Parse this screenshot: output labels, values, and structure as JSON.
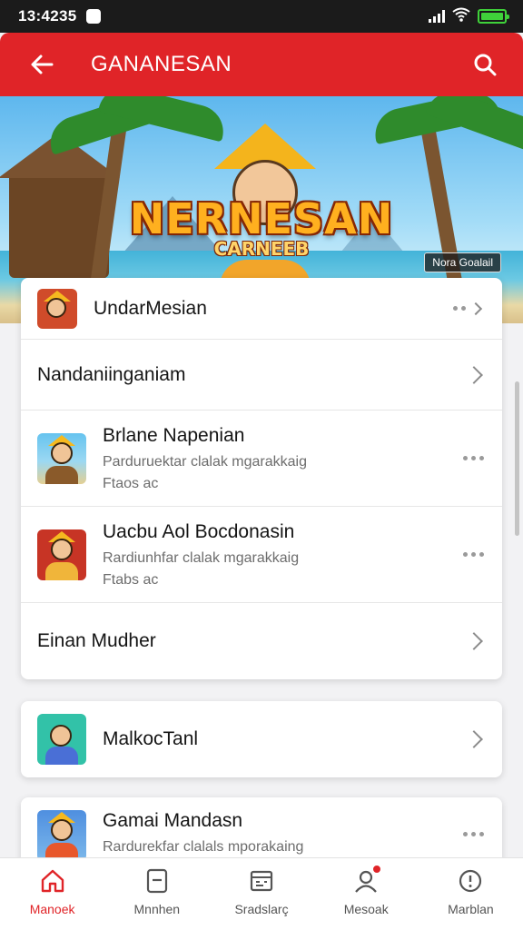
{
  "status_bar": {
    "time": "13:4235"
  },
  "app_bar": {
    "title": "GANANESAN"
  },
  "banner": {
    "logo_line1": "NERNESAN",
    "logo_line2": "CARNEEB",
    "tag": "Nora Goalail"
  },
  "list1": {
    "rows": [
      {
        "title": "UndarMesian"
      },
      {
        "title": "Nandaniinganiam"
      },
      {
        "title": "Brlane Napenian",
        "subtitle": "Parduruektar clalak mgarakkaig",
        "meta": "Ftaos ac"
      },
      {
        "title": "Uacbu Aol Bocdonasin",
        "subtitle": "Rardiunhfar clalak mgarakkaig",
        "meta": "Ftabs ac"
      },
      {
        "title": "Einan Mudher"
      }
    ]
  },
  "list2": {
    "title": "MalkocTanl"
  },
  "list3": {
    "title": "Gamai Mandasn",
    "subtitle": "Rardurekfar clalals mporakaing"
  },
  "bottom_nav": {
    "items": [
      {
        "label": "Manoek",
        "icon": "home-icon",
        "active": true
      },
      {
        "label": "Mnnhen",
        "icon": "tablet-icon"
      },
      {
        "label": "Sradslarç",
        "icon": "calendar-icon"
      },
      {
        "label": "Mesoak",
        "icon": "profile-icon",
        "badge": true
      },
      {
        "label": "Marblan",
        "icon": "info-icon"
      }
    ]
  },
  "colors": {
    "accent": "#e02428",
    "status_bg": "#1b1b1b",
    "battery": "#3fd23a"
  }
}
